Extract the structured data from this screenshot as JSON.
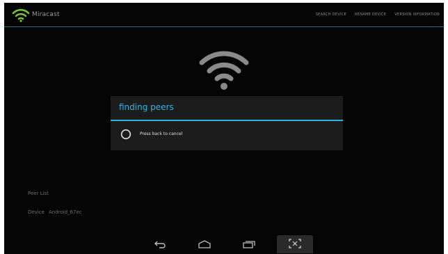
{
  "app": {
    "title": "Miracast",
    "icon": "wifi-icon"
  },
  "menu": {
    "items": [
      "SEARCH DEVICE",
      "RENAME DEVICE",
      "VERSION INFORMATION"
    ]
  },
  "main": {
    "icon": "wifi-icon"
  },
  "dialog": {
    "title": "finding peers",
    "message": "Press back to cancel",
    "icon": "spinner-icon"
  },
  "peers": {
    "heading": "Peer List",
    "device_label": "Device",
    "device_name": "Android_67ec"
  },
  "navbar": {
    "icons": [
      "back-icon",
      "home-icon",
      "recent-apps-icon",
      "screenshot-icon"
    ]
  },
  "colors": {
    "accent": "#33b5e5",
    "background": "#050505",
    "dialog": "#1c1c1c"
  }
}
